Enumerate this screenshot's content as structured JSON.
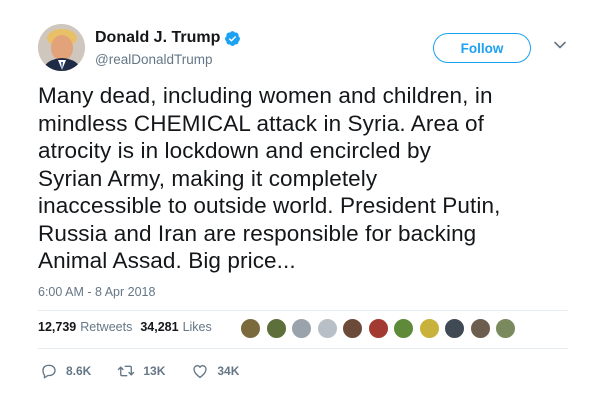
{
  "user": {
    "display_name": "Donald J. Trump",
    "handle": "@realDonaldTrump",
    "verified": true
  },
  "follow_label": "Follow",
  "tweet": {
    "text": "Many dead, including women and children, in\nmindless CHEMICAL attack in Syria. Area of\natrocity is in lockdown and encircled by\nSyrian Army, making it completely\ninaccessible to outside world. President Putin,\nRussia and Iran are responsible for backing\nAnimal Assad. Big price...",
    "timestamp": "6:00 AM - 8 Apr 2018"
  },
  "stats": {
    "retweets": "12,739",
    "retweets_label": "Retweets",
    "likes": "34,281",
    "likes_label": "Likes"
  },
  "liker_avatars": [
    "#7a6a3c",
    "#5d6f3a",
    "#9aa3ab",
    "#b9bfc6",
    "#6b4a3a",
    "#a33a32",
    "#5e8a3a",
    "#c9b23c",
    "#3f4a55",
    "#6d5d4f",
    "#7b8a5e"
  ],
  "actions": {
    "reply_count": "8.6K",
    "retweet_count": "13K",
    "like_count": "34K"
  },
  "colors": {
    "accent": "#1da1f2",
    "secondary_text": "#657786",
    "primary_text": "#14171a"
  },
  "icons": [
    "verified-badge-icon",
    "chevron-down-icon",
    "reply-icon",
    "retweet-icon",
    "heart-icon"
  ]
}
